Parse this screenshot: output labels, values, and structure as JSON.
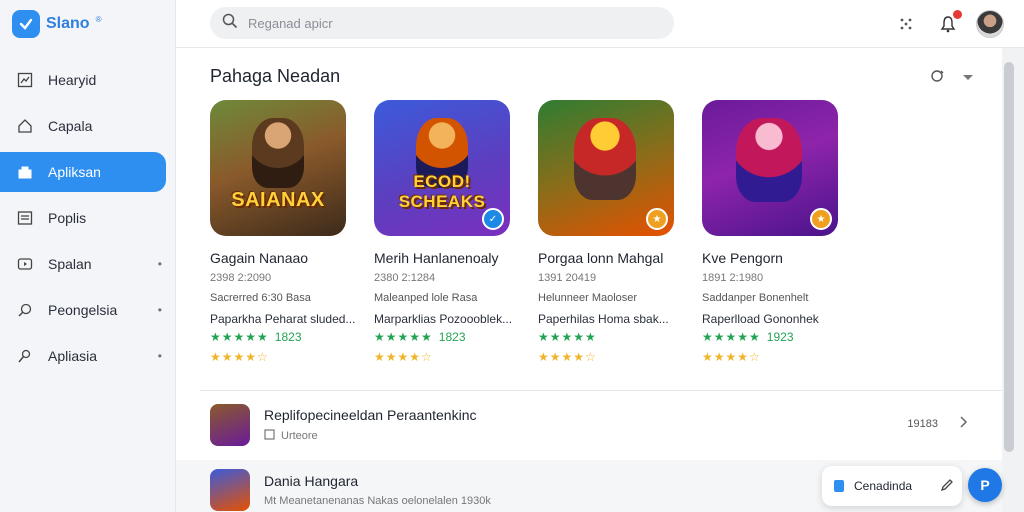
{
  "brand": {
    "name": "Slano",
    "sup": "®"
  },
  "search": {
    "placeholder": "Reganad apicr"
  },
  "sidebar": {
    "items": [
      {
        "label": "Hearyid",
        "icon": "chart-icon",
        "active": false,
        "has_dot": false
      },
      {
        "label": "Capala",
        "icon": "home-icon",
        "active": false,
        "has_dot": false
      },
      {
        "label": "Apliksan",
        "icon": "store-icon",
        "active": true,
        "has_dot": false
      },
      {
        "label": "Poplis",
        "icon": "list-icon",
        "active": false,
        "has_dot": false
      },
      {
        "label": "Spalan",
        "icon": "video-icon",
        "active": false,
        "has_dot": true
      },
      {
        "label": "Peongelsia",
        "icon": "search-icon",
        "active": false,
        "has_dot": true
      },
      {
        "label": "Apliasia",
        "icon": "pin-icon",
        "active": false,
        "has_dot": true
      }
    ],
    "dot": "•"
  },
  "main": {
    "section_title": "Pahaga Neadan",
    "cards": [
      {
        "art_text": "SAIANAX",
        "title": "Gagain Nanaao",
        "meta1": "2398 2:2090",
        "meta2": "Sacrerred 6:30 Basa",
        "desc": "Paparkha Peharat sluded...",
        "stars": "★★★★★",
        "reviews": "1823",
        "stars2": "★★★★☆",
        "colors": [
          "#8a5a2b",
          "#3c2a1a"
        ],
        "badge_color": "#f0a020"
      },
      {
        "art_text": "ECOD! SCHEAKS",
        "title": "Merih Hanlanenoaly",
        "meta1": "2380 2:1284",
        "meta2": "Maleanped lole Rasa",
        "desc": "Marparklias Pozoooblek...",
        "stars": "★★★★★",
        "reviews": "1823",
        "stars2": "★★★★☆",
        "colors": [
          "#3b5bdb",
          "#7b2fbf"
        ],
        "badge_color": "#1e88e5"
      },
      {
        "art_text": "",
        "title": "Porgaa lonn Mahgal",
        "meta1": "1391 20419",
        "meta2": "Helunneer Maoloser",
        "desc": "Paperhilas Homa sbak...",
        "stars": "★★★★★",
        "reviews": "",
        "stars2": "★★★★☆",
        "colors": [
          "#2e7d32",
          "#e65100"
        ],
        "badge_color": "#f0a020"
      },
      {
        "art_text": "",
        "title": "Kve Pengorn",
        "meta1": "1891 2:1980",
        "meta2": "Saddanper Bonenhelt",
        "desc": "Raperlload Gononhek",
        "stars": "★★★★★",
        "reviews": "1923",
        "stars2": "★★★★☆",
        "colors": [
          "#8e24aa",
          "#4a148c"
        ],
        "badge_color": "#f0a020"
      }
    ]
  },
  "list": [
    {
      "title": "Replifopecineeldan Peraantenkinc",
      "sub": "Urteore",
      "right_text": "19183"
    },
    {
      "title": "Dania Hangara",
      "sub": "Mt Meanetanenanas Nakas oelonelalen 1930k",
      "right_text": ""
    }
  ],
  "float": {
    "label": "Cenadinda"
  },
  "fab": {
    "label": "P"
  },
  "colors": {
    "accent": "#2f8ff1",
    "star_green": "#23a455",
    "star_yellow": "#f0b429"
  }
}
